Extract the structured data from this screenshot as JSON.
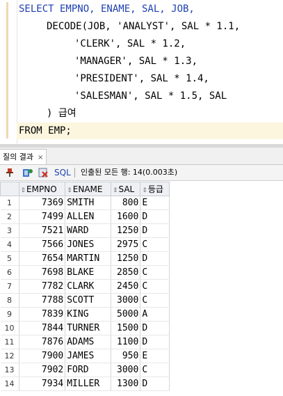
{
  "editor": {
    "lines": [
      "SELECT EMPNO, ENAME, SAL, JOB,",
      "DECODE(JOB, 'ANALYST', SAL * 1.1,",
      "'CLERK', SAL * 1.2,",
      "'MANAGER', SAL * 1.3,",
      "'PRESIDENT', SAL * 1.4,",
      "'SALESMAN', SAL * 1.5, SAL",
      ") 급여",
      "FROM EMP;"
    ]
  },
  "results": {
    "tab_label": "질의 결과",
    "tab_close": "×",
    "toolbar": {
      "sql_label": "SQL",
      "status": "인출된 모든 행: 14(0.003초)"
    },
    "columns": [
      "EMPNO",
      "ENAME",
      "SAL",
      "등급"
    ],
    "rows": [
      {
        "n": "1",
        "empno": "7369",
        "ename": "SMITH",
        "sal": "800",
        "grade": "E"
      },
      {
        "n": "2",
        "empno": "7499",
        "ename": "ALLEN",
        "sal": "1600",
        "grade": "D"
      },
      {
        "n": "3",
        "empno": "7521",
        "ename": "WARD",
        "sal": "1250",
        "grade": "D"
      },
      {
        "n": "4",
        "empno": "7566",
        "ename": "JONES",
        "sal": "2975",
        "grade": "C"
      },
      {
        "n": "5",
        "empno": "7654",
        "ename": "MARTIN",
        "sal": "1250",
        "grade": "D"
      },
      {
        "n": "6",
        "empno": "7698",
        "ename": "BLAKE",
        "sal": "2850",
        "grade": "C"
      },
      {
        "n": "7",
        "empno": "7782",
        "ename": "CLARK",
        "sal": "2450",
        "grade": "C"
      },
      {
        "n": "8",
        "empno": "7788",
        "ename": "SCOTT",
        "sal": "3000",
        "grade": "C"
      },
      {
        "n": "9",
        "empno": "7839",
        "ename": "KING",
        "sal": "5000",
        "grade": "A"
      },
      {
        "n": "10",
        "empno": "7844",
        "ename": "TURNER",
        "sal": "1500",
        "grade": "D"
      },
      {
        "n": "11",
        "empno": "7876",
        "ename": "ADAMS",
        "sal": "1100",
        "grade": "D"
      },
      {
        "n": "12",
        "empno": "7900",
        "ename": "JAMES",
        "sal": "950",
        "grade": "E"
      },
      {
        "n": "13",
        "empno": "7902",
        "ename": "FORD",
        "sal": "3000",
        "grade": "C"
      },
      {
        "n": "14",
        "empno": "7934",
        "ename": "MILLER",
        "sal": "1300",
        "grade": "D"
      }
    ]
  },
  "colors": {
    "keyword": "#1e3fb0",
    "current_line": "#fbf6dd",
    "grid_header": "#eef0f3"
  },
  "icons": [
    "pin-icon",
    "refresh-icon",
    "export-icon"
  ]
}
